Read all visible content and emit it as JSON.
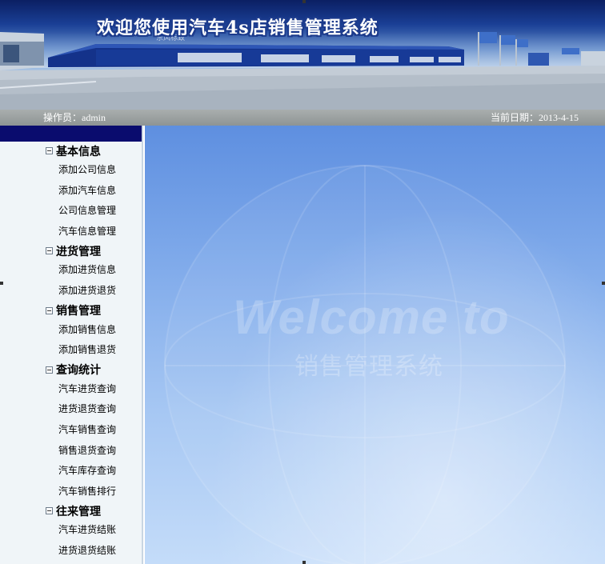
{
  "banner": {
    "title": "欢迎您使用汽车4s店销售管理系统"
  },
  "info_bar": {
    "operator_label": "操作员：admin",
    "date_label": "当前日期：2013-4-15"
  },
  "sidebar": {
    "groups": [
      {
        "title": "基本信息",
        "icon": "collapse-box-icon",
        "items": [
          "添加公司信息",
          "添加汽车信息",
          "公司信息管理",
          "汽车信息管理"
        ]
      },
      {
        "title": "进货管理",
        "icon": "collapse-box-icon",
        "items": [
          "添加进货信息",
          "添加进货退货"
        ]
      },
      {
        "title": "销售管理",
        "icon": "collapse-box-icon",
        "items": [
          "添加销售信息",
          "添加销售退货"
        ]
      },
      {
        "title": "查询统计",
        "icon": "collapse-box-icon",
        "items": [
          "汽车进货查询",
          "进货退货查询",
          "汽车销售查询",
          "销售退货查询",
          "汽车库存查询",
          "汽车销售排行"
        ]
      },
      {
        "title": "往来管理",
        "icon": "collapse-box-icon",
        "items": [
          "汽车进货结账",
          "进货退货结账"
        ]
      }
    ]
  },
  "main": {
    "welcome_text": "Welcome to",
    "welcome_sub": "销售管理系统"
  },
  "colors": {
    "sidebar_header": "#0a0c6e",
    "info_bar": "#9a9f9f",
    "main_bg": "#7ea9ea"
  }
}
